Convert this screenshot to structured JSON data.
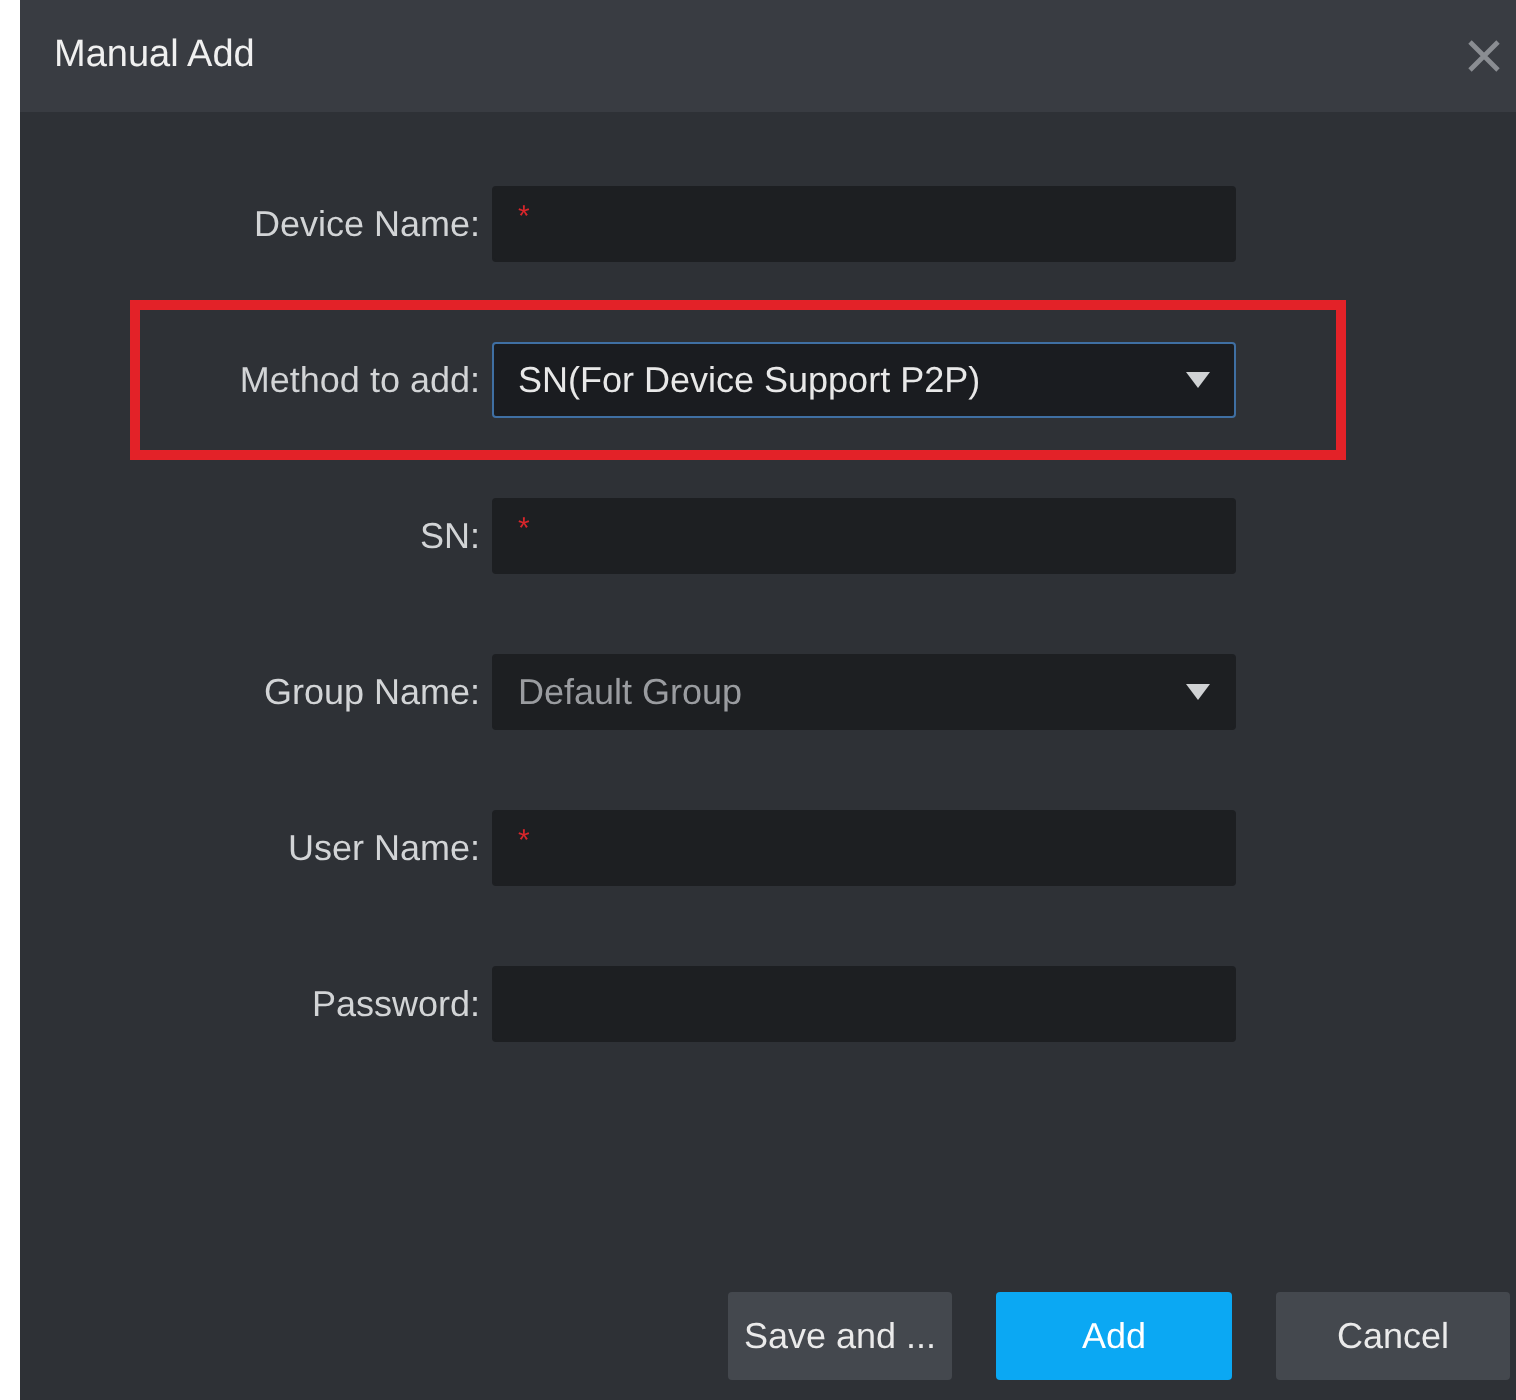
{
  "window": {
    "title": "Manual Add"
  },
  "fields": [
    {
      "label": "Device Name:",
      "kind": "text",
      "required_mark": "*",
      "highlighted": false,
      "focused": false
    },
    {
      "label": "Method to add:",
      "kind": "select",
      "value": "SN(For Device Support P2P)",
      "highlighted": true,
      "focused": true
    },
    {
      "label": "SN:",
      "kind": "text",
      "required_mark": "*",
      "highlighted": false,
      "focused": false
    },
    {
      "label": "Group Name:",
      "kind": "select",
      "value": "Default Group",
      "highlighted": false,
      "focused": false
    },
    {
      "label": "User Name:",
      "kind": "text",
      "required_mark": "*",
      "highlighted": false,
      "focused": false
    },
    {
      "label": "Password:",
      "kind": "text",
      "highlighted": false,
      "focused": false
    }
  ],
  "buttons": [
    {
      "label": "Save and ...",
      "primary": false
    },
    {
      "label": "Add",
      "primary": true
    },
    {
      "label": "Cancel",
      "primary": false
    }
  ]
}
